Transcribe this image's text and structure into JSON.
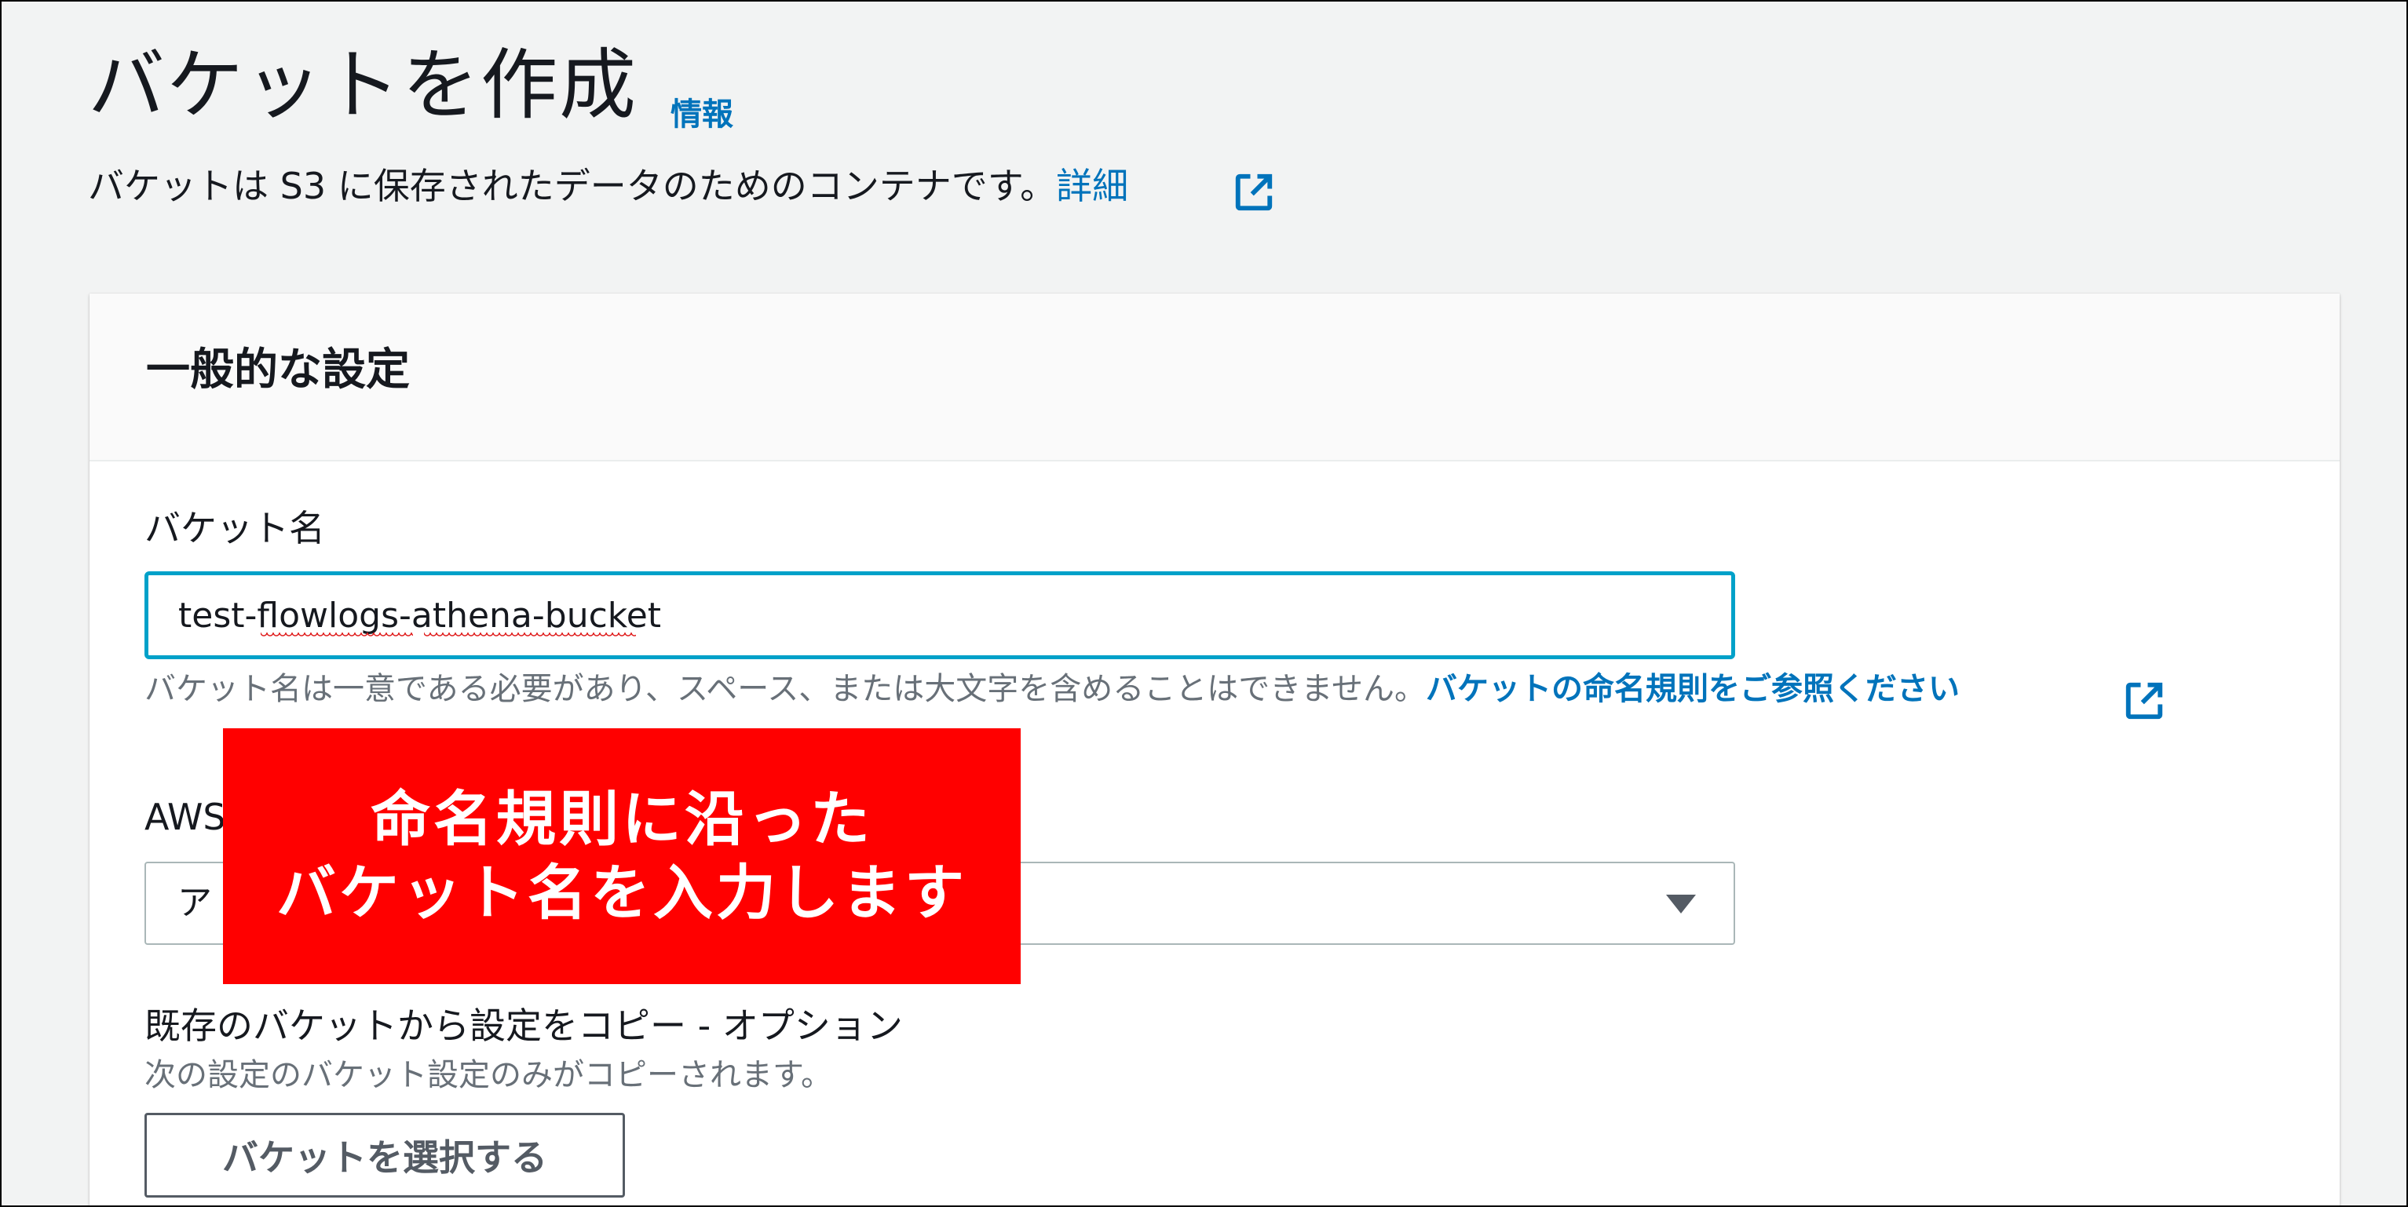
{
  "header": {
    "title": "バケットを作成",
    "info_link": "情報",
    "subtitle": "バケットは S3 に保存されたデータのためのコンテナです。",
    "detail_link": "詳細"
  },
  "general": {
    "section_title": "一般的な設定",
    "bucket_name_label": "バケット名",
    "bucket_name_value": "test-flowlogs-athena-bucket",
    "bucket_name_help": "バケット名は一意である必要があり、スペース、または大文字を含めることはできません。",
    "naming_rules_link": "バケットの命名規則をご参照ください",
    "region_label_visible": "AWS",
    "region_value_visible": "ア",
    "copy_label": "既存のバケットから設定をコピー - オプション",
    "copy_description": "次の設定のバケット設定のみがコピーされます。",
    "choose_bucket_button": "バケットを選択する"
  },
  "callout": {
    "line1": "命名規則に沿った",
    "line2": "バケット名を入力します"
  },
  "colors": {
    "link": "#0073bb",
    "input_focus_border": "#00a1c9",
    "callout_bg": "#ff0000",
    "page_bg": "#f2f3f3"
  },
  "icons": {
    "external_link": "external-link-icon",
    "dropdown": "caret-down-icon"
  }
}
